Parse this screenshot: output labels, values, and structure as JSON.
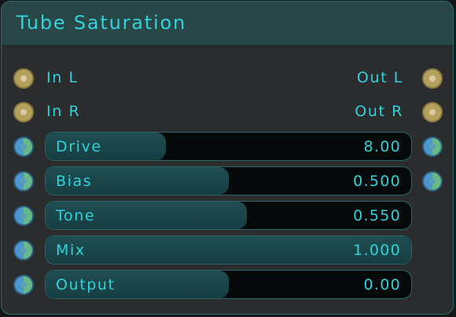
{
  "title": "Tube Saturation",
  "ports": {
    "in_l": "In L",
    "in_r": "In R",
    "out_l": "Out L",
    "out_r": "Out R"
  },
  "params": [
    {
      "label": "Drive",
      "value": "8.00",
      "fill": 0.33
    },
    {
      "label": "Bias",
      "value": "0.500",
      "fill": 0.5
    },
    {
      "label": "Tone",
      "value": "0.550",
      "fill": 0.55
    },
    {
      "label": "Mix",
      "value": "1.000",
      "fill": 1.0
    },
    {
      "label": "Output",
      "value": "0.00",
      "fill": 0.5
    }
  ],
  "colors": {
    "accent": "#2fd3d9",
    "audio_port": "#b2a05c",
    "cv_port_left": "#4c97cf",
    "cv_port_right": "#67b985"
  }
}
